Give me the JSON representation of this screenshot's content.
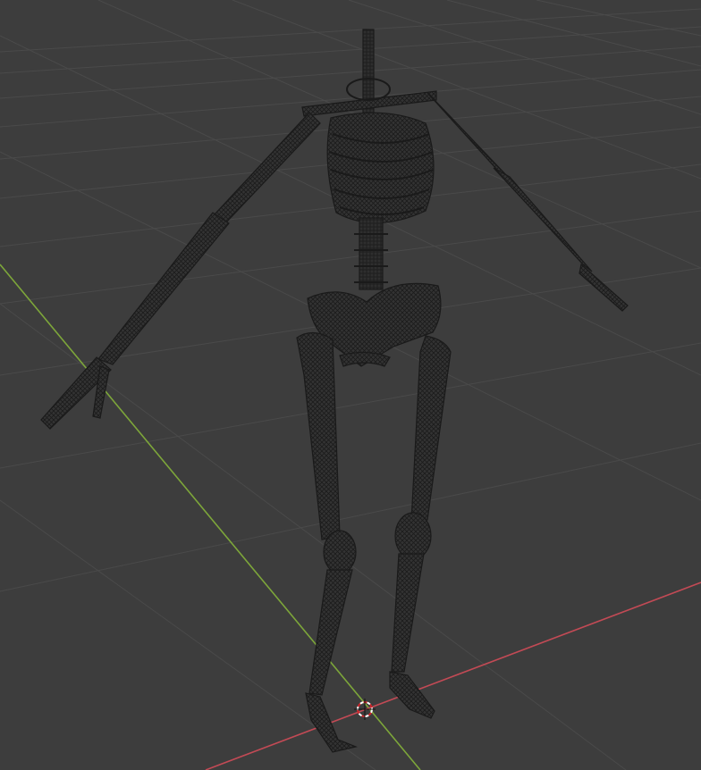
{
  "viewport": {
    "background": "#3d3d3d",
    "grid_color": "#4a4a4a",
    "axis_x_color": "#c24a55",
    "axis_y_color": "#7da63a",
    "mesh_color": "#1e1e1e",
    "mesh_fill": "#303030",
    "cursor_color_a": "#d0262b",
    "cursor_color_b": "#ffffff",
    "shading": "wireframe",
    "object": "skeleton"
  }
}
